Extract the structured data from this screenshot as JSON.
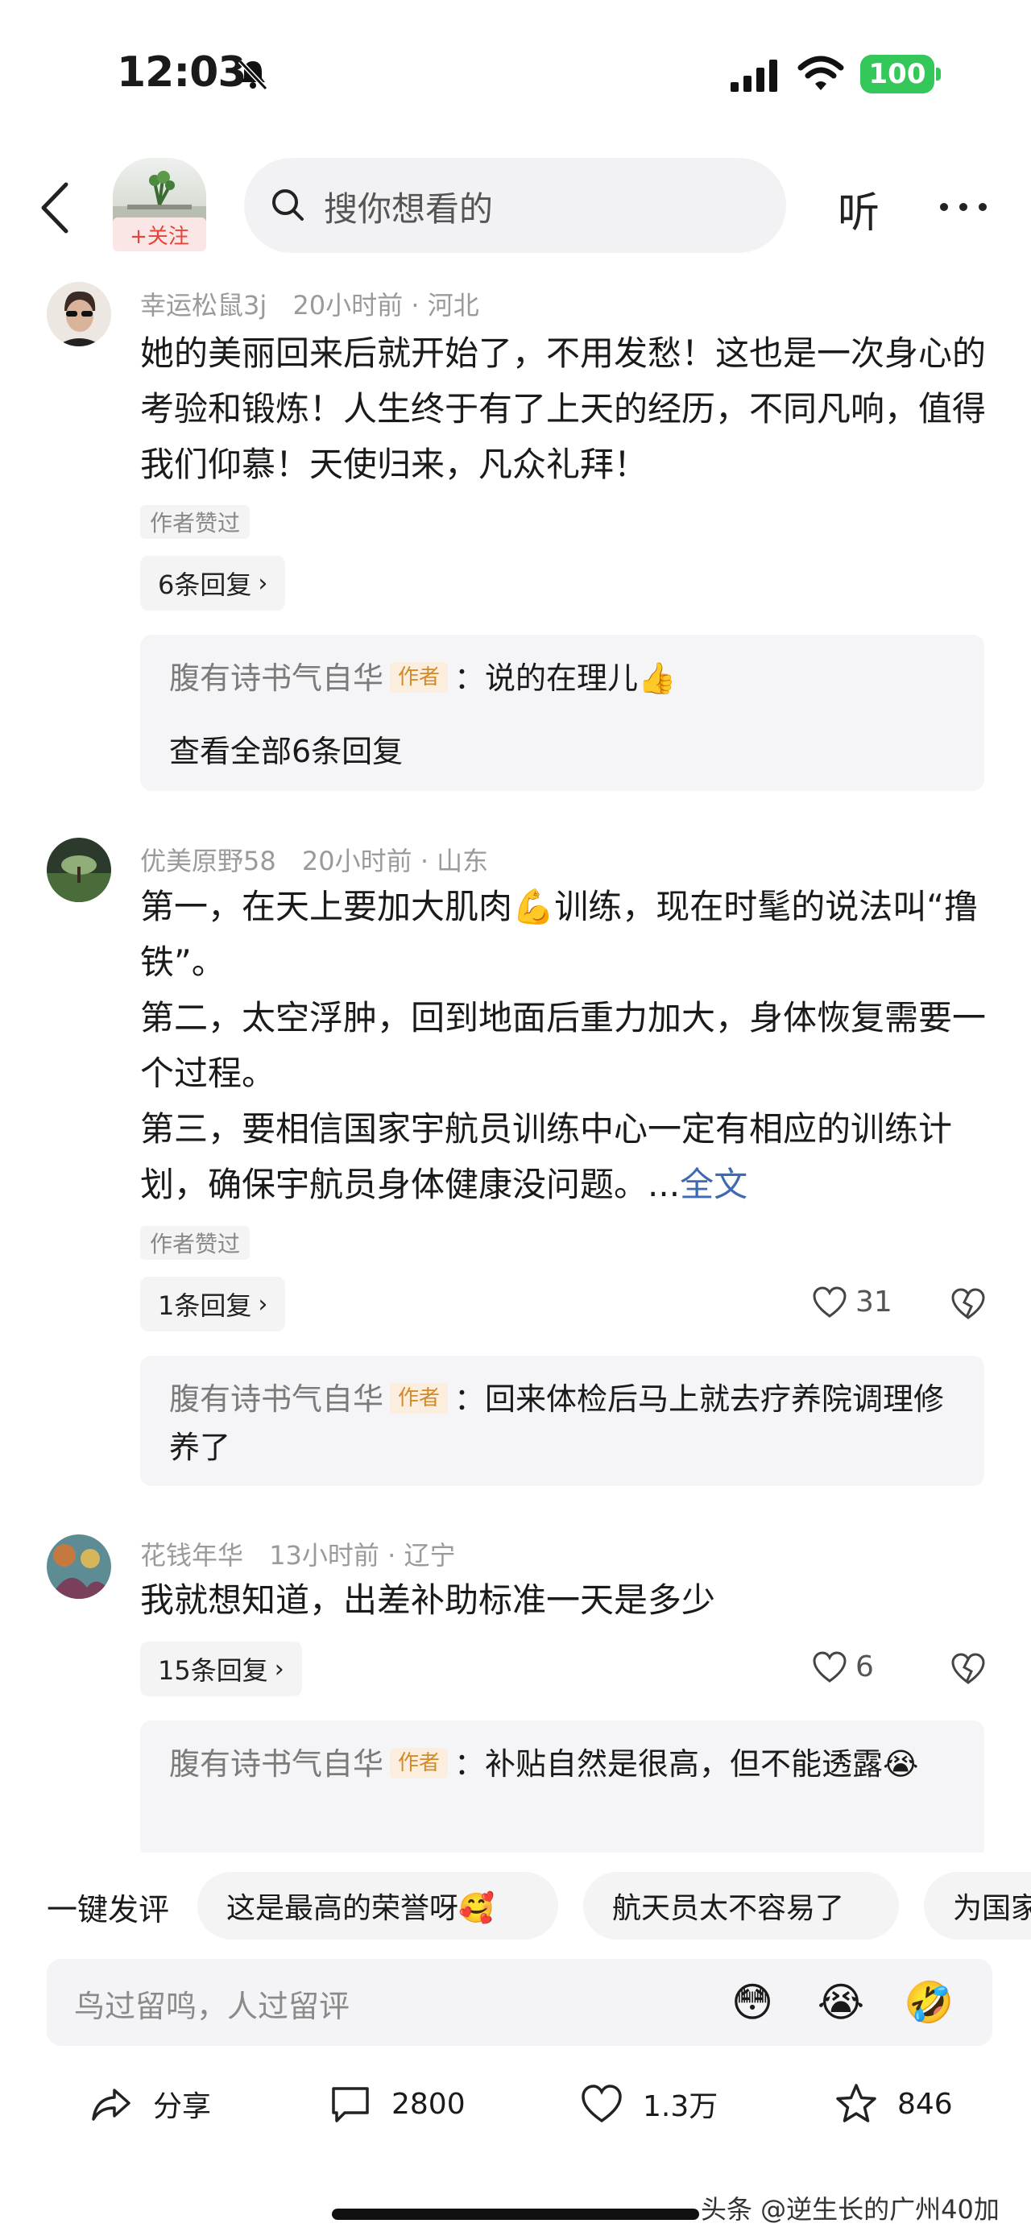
{
  "status_bar": {
    "time": "12:03",
    "battery": "100"
  },
  "nav": {
    "follow_label": "+关注",
    "search_placeholder": "搜你想看的",
    "listen_label": "听"
  },
  "comments": [
    {
      "username": "幸运松鼠3j",
      "time": "20小时前",
      "location": "河北",
      "text": "她的美丽回来后就开始了，不用发愁！这也是一次身心的考验和锻炼！人生终于有了上天的经历，不同凡响，值得我们仰慕！天使归来，凡众礼拜！",
      "author_liked": "作者赞过",
      "replies_label": "6条回复",
      "reply": {
        "user": "腹有诗书气自华",
        "tag": "作者",
        "text": "：说的在理儿",
        "emoji": "👍"
      },
      "view_all": "查看全部6条回复"
    },
    {
      "username": "优美原野58",
      "time": "20小时前",
      "location": "山东",
      "lines": [
        "第一，在天上要加大肌肉💪训练，现在时髦的说法叫“撸铁”。",
        "第二，太空浮肿，回到地面后重力加大，身体恢复需要一个过程。",
        "第三，要相信国家宇航员训练中心一定有相应的训练计划，确保宇航员身体健康没问题。..."
      ],
      "full_text_link": "全文",
      "author_liked": "作者赞过",
      "replies_label": "1条回复",
      "likes": "31",
      "reply": {
        "user": "腹有诗书气自华",
        "tag": "作者",
        "text": "：回来体检后马上就去疗养院调理修养了"
      }
    },
    {
      "username": "花钱年华",
      "time": "13小时前",
      "location": "辽宁",
      "text": "我就想知道，出差补助标准一天是多少",
      "replies_label": "15条回复",
      "likes": "6",
      "reply": {
        "user": "腹有诗书气自华",
        "tag": "作者",
        "text": "：补贴自然是很高，但不能透露",
        "emoji": "😭"
      }
    }
  ],
  "quick_comment": {
    "label": "一键发评",
    "chips": [
      "这是最高的荣誉呀🥰",
      "航天员太不容易了",
      "为国家"
    ],
    "input_placeholder": "鸟过留鸣，人过留评",
    "emojis": [
      "😳",
      "😭",
      "🤣"
    ]
  },
  "actions": {
    "share": "分享",
    "comments": "2800",
    "likes": "1.3万",
    "favorites": "846"
  },
  "watermark": "头条 @逆生长的广州40加",
  "separator": " · "
}
